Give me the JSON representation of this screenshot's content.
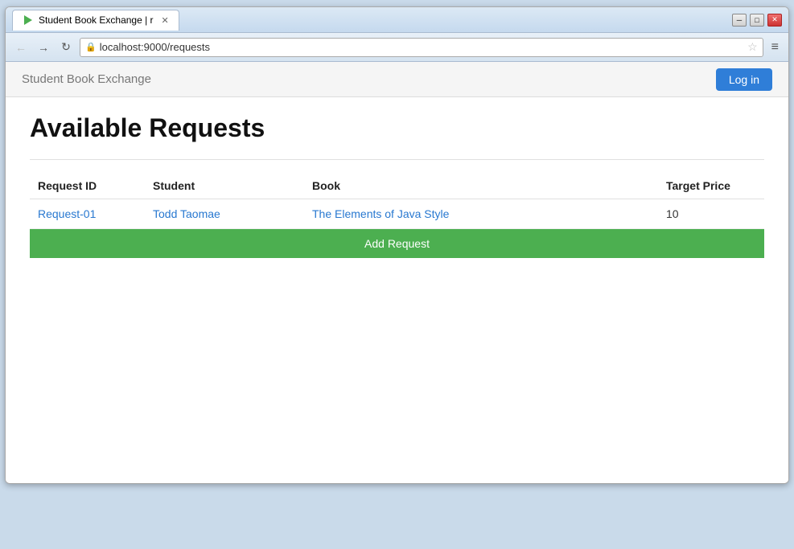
{
  "browser": {
    "tab_title": "Student Book Exchange | r",
    "url": "localhost:9000/requests",
    "minimize_symbol": "─",
    "maximize_symbol": "□",
    "close_symbol": "✕",
    "back_symbol": "←",
    "forward_symbol": "→",
    "refresh_symbol": "↻",
    "menu_symbol": "≡",
    "star_symbol": "☆"
  },
  "navbar": {
    "brand": "Student Book Exchange",
    "login_label": "Log in"
  },
  "page": {
    "title": "Available Requests",
    "table": {
      "columns": [
        "Request ID",
        "Student",
        "Book",
        "Target Price"
      ],
      "rows": [
        {
          "request_id": "Request-01",
          "student": "Todd Taomae",
          "book": "The Elements of Java Style",
          "target_price": "10"
        }
      ]
    },
    "add_request_label": "Add Request"
  }
}
